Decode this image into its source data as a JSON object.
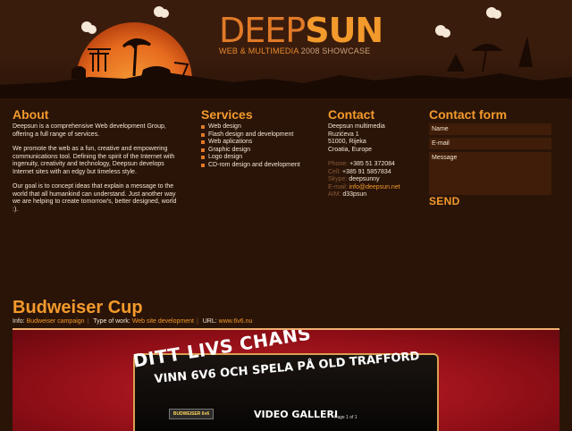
{
  "logo": {
    "deep": "DEEP",
    "sun": "SUN",
    "sub": "WEB & MULTIMEDIA",
    "year": "2008 SHOWCASE"
  },
  "about": {
    "title": "About",
    "paragraphs": [
      "Deepsun is a comprehensive Web development Group, offering a full range of services.",
      "We promote the web as a fun, creative and empowering communications tool. Defining the spirit of the Internet with ingenuity, creativity and technology, Deepsun develops Internet sites with an edgy but timeless style.",
      "Our goal is to concept ideas that explain a message to the world that all humankind can understand. Just another way we are helping to create tomorrow's, better designed, world :)."
    ]
  },
  "services": {
    "title": "Services",
    "items": [
      "Web design",
      "Flash design and development",
      "Web aplications",
      "Graphic design",
      "Logo design",
      "CD-rom design and development"
    ]
  },
  "contact": {
    "title": "Contact",
    "address": [
      "Deepsun multimedia",
      "Ruzićeva 1",
      "51000, Rijeka",
      "Croatia, Europe"
    ],
    "phone_label": "Phone:",
    "phone": "+385 51 372084",
    "cell_label": "Cell:",
    "cell": "+385 91 5857834",
    "skype_label": "Skype:",
    "skype": "deepsunny",
    "email_label": "E-mail:",
    "email": "info@deepsun.net",
    "aim_label": "AIM:",
    "aim": "d33psun"
  },
  "contact_form": {
    "title": "Contact form",
    "name_placeholder": "Name",
    "email_placeholder": "E-mail",
    "message_placeholder": "Message",
    "send_label": "SEND"
  },
  "project": {
    "title": "Budweiser Cup",
    "info_label": "Info:",
    "info_value": "Budweiser campaign",
    "type_label": "Type of work:",
    "type_value": "Web site development",
    "url_label": "URL:",
    "url_value": "www.6v6.nu"
  },
  "screenshot": {
    "headline": "DITT LIVS CHANS",
    "subheadline": "VINN 6V6 OCH SPELA PÅ OLD TRAFFORD",
    "badge": "BUDWEISER 6v6",
    "gallery": "VIDEO GALLERI",
    "page": "Page 1 of 1"
  },
  "colors": {
    "accent": "#f39a2c",
    "background": "#2a1408",
    "text": "#f5e6d0"
  }
}
